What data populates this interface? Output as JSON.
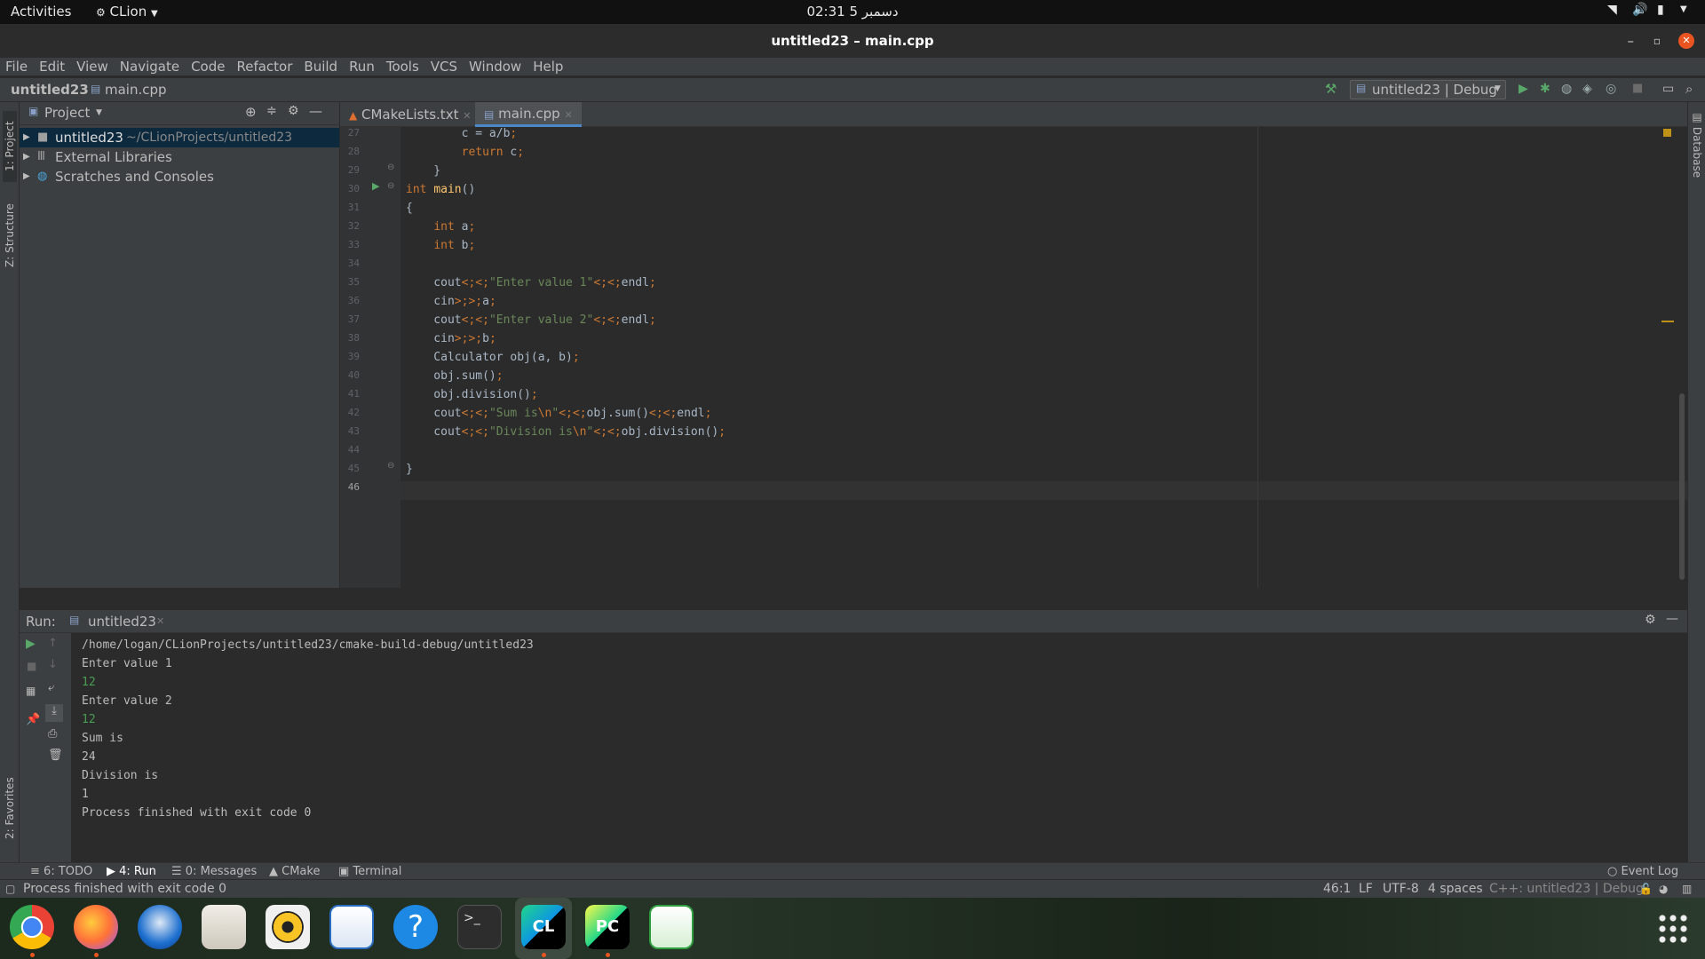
{
  "system_bar": {
    "activities": "Activities",
    "app_name": "CLion",
    "clock": "02:31  دسمبر 5"
  },
  "window": {
    "title": "untitled23 – main.cpp"
  },
  "menu": [
    "File",
    "Edit",
    "View",
    "Navigate",
    "Code",
    "Refactor",
    "Build",
    "Run",
    "Tools",
    "VCS",
    "Window",
    "Help"
  ],
  "navbar": {
    "project": "untitled23",
    "file": "main.cpp",
    "run_config": "untitled23 | Debug"
  },
  "project_panel": {
    "title": "Project",
    "tree": [
      {
        "label": "untitled23",
        "path": "~/CLionProjects/untitled23"
      },
      {
        "label": "External Libraries"
      },
      {
        "label": "Scratches and Consoles"
      }
    ]
  },
  "side_tabs": {
    "project": "1: Project",
    "structure": "Z: Structure",
    "favorites": "2: Favorites",
    "database": "Database"
  },
  "editor": {
    "tabs": [
      {
        "label": "CMakeLists.txt",
        "active": false
      },
      {
        "label": "main.cpp",
        "active": true
      }
    ],
    "lines": [
      {
        "n": "27",
        "text": "        c = a/b;"
      },
      {
        "n": "28",
        "text": "        return c;"
      },
      {
        "n": "29",
        "text": "    }"
      },
      {
        "n": "30",
        "text": "int main()"
      },
      {
        "n": "31",
        "text": "{"
      },
      {
        "n": "32",
        "text": "    int a;"
      },
      {
        "n": "33",
        "text": "    int b;"
      },
      {
        "n": "34",
        "text": ""
      },
      {
        "n": "35",
        "text": "    cout<<\"Enter value 1\"<<endl;"
      },
      {
        "n": "36",
        "text": "    cin>>a;"
      },
      {
        "n": "37",
        "text": "    cout<<\"Enter value 2\"<<endl;"
      },
      {
        "n": "38",
        "text": "    cin>>b;"
      },
      {
        "n": "39",
        "text": "    Calculator obj(a, b);"
      },
      {
        "n": "40",
        "text": "    obj.sum();"
      },
      {
        "n": "41",
        "text": "    obj.division();"
      },
      {
        "n": "42",
        "text": "    cout<<\"Sum is\\n\"<<obj.sum()<<endl;"
      },
      {
        "n": "43",
        "text": "    cout<<\"Division is\\n\"<<obj.division();"
      },
      {
        "n": "44",
        "text": ""
      },
      {
        "n": "45",
        "text": "}"
      },
      {
        "n": "46",
        "text": ""
      }
    ]
  },
  "run_panel": {
    "label": "Run:",
    "tab": "untitled23",
    "output": [
      {
        "text": "/home/logan/CLionProjects/untitled23/cmake-build-debug/untitled23",
        "input": false
      },
      {
        "text": "Enter value 1",
        "input": false
      },
      {
        "text": "12",
        "input": true
      },
      {
        "text": "Enter value 2",
        "input": false
      },
      {
        "text": "12",
        "input": true
      },
      {
        "text": "Sum is",
        "input": false
      },
      {
        "text": "24",
        "input": false
      },
      {
        "text": "Division is",
        "input": false
      },
      {
        "text": "1",
        "input": false
      },
      {
        "text": "Process finished with exit code 0",
        "input": false
      }
    ]
  },
  "bottom_tabs": {
    "todo": "6: TODO",
    "run": "4: Run",
    "messages": "0: Messages",
    "cmake": "CMake",
    "terminal": "Terminal",
    "event_log": "Event Log"
  },
  "status": {
    "message": "Process finished with exit code 0",
    "position": "46:1",
    "line_sep": "LF",
    "encoding": "UTF-8",
    "indent": "4 spaces",
    "context": "C++: untitled23 | Debug"
  },
  "dock": [
    "chrome-icon",
    "firefox-icon",
    "thunderbird-icon",
    "files-icon",
    "rhythmbox-icon",
    "writer-icon",
    "help-icon",
    "terminal-icon",
    "clion-icon",
    "pycharm-icon",
    "calc-icon"
  ],
  "colors": {
    "keyword": "#cc7832",
    "string": "#6a8759",
    "function": "#ffc66d",
    "input_echo": "#499c54",
    "run_green": "#59a869"
  }
}
